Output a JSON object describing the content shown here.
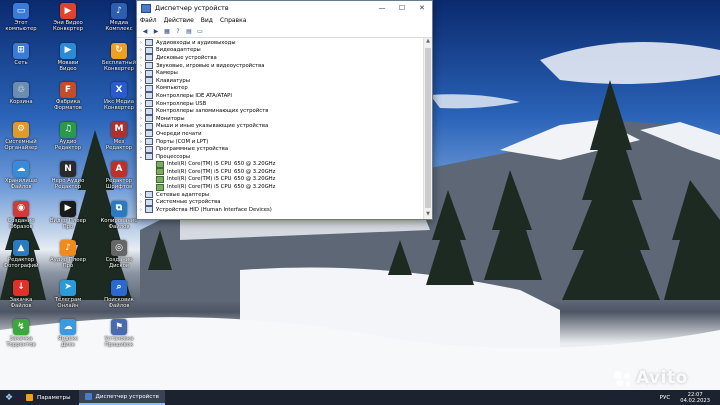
{
  "window": {
    "title": "Диспетчер устройств",
    "menu": [
      "Файл",
      "Действие",
      "Вид",
      "Справка"
    ],
    "categories_before": [
      "Аудиовходы и аудиовыходы",
      "Видеоадаптеры",
      "Дисковые устройства",
      "Звуковые, игровые и видеоустройства",
      "Камеры",
      "Клавиатуры",
      "Компьютер",
      "Контроллеры IDE ATA/ATAPI",
      "Контроллеры USB",
      "Контроллеры запоминающих устройств",
      "Мониторы",
      "Мыши и иные указывающие устройства",
      "Очереди печати",
      "Порты (COM и LPT)",
      "Программные устройства"
    ],
    "expanded_category": "Процессоры",
    "processors": [
      {
        "name": "Intel(R) Core(TM) i5 CPU",
        "speed": "650 @ 3.20GHz"
      },
      {
        "name": "Intel(R) Core(TM) i5 CPU",
        "speed": "650 @ 3.20GHz"
      },
      {
        "name": "Intel(R) Core(TM) i5 CPU",
        "speed": "650 @ 3.20GHz"
      },
      {
        "name": "Intel(R) Core(TM) i5 CPU",
        "speed": "650 @ 3.20GHz"
      }
    ],
    "categories_after": [
      "Сетевые адаптеры",
      "Системные устройства",
      "Устройства HID (Human Interface Devices)"
    ]
  },
  "desktop_icons": [
    {
      "label": "Этот\nкомпьютер",
      "color": "#3b7bd8",
      "glyph": "▭",
      "name": "computer-icon"
    },
    {
      "label": "Эни Видео\nКонвертер",
      "color": "#e0432d",
      "glyph": "▶",
      "name": "video-converter-icon"
    },
    {
      "label": "Медиа\nКомплекс",
      "color": "#2d5fb0",
      "glyph": "♪",
      "name": "media-icon"
    },
    {
      "label": "Сеть",
      "color": "#3b7bd8",
      "glyph": "⊞",
      "name": "network-icon"
    },
    {
      "label": "Мовави\nВидео",
      "color": "#2c8ad6",
      "glyph": "▶",
      "name": "video-editor-icon"
    },
    {
      "label": "Бесплатный\nКонвертер",
      "color": "#f0a020",
      "glyph": "↻",
      "name": "converter-icon"
    },
    {
      "label": "Корзина",
      "color": "#6a8db0",
      "glyph": "♲",
      "name": "recycle-bin-icon"
    },
    {
      "label": "Фабрика\nФорматов",
      "color": "#c54b2a",
      "glyph": "F",
      "name": "format-factory-icon"
    },
    {
      "label": "Икс Медиа\nКонвертер",
      "color": "#2a5ad0",
      "glyph": "X",
      "name": "media-converter-icon"
    },
    {
      "label": "Системный\nОрганайзер",
      "color": "#e09a2a",
      "glyph": "⚙",
      "name": "organizer-icon"
    },
    {
      "label": "Аудио\nРедактор",
      "color": "#2a9a4a",
      "glyph": "♫",
      "name": "audio-editor-icon"
    },
    {
      "label": "Мез\nРедактор",
      "color": "#b03030",
      "glyph": "M",
      "name": "editor-icon"
    },
    {
      "label": "Хранилище\nФайлов",
      "color": "#3a8ad8",
      "glyph": "☁",
      "name": "storage-icon"
    },
    {
      "label": "Неро Аудио\nРедактор",
      "color": "#2a2a2a",
      "glyph": "N",
      "name": "nero-icon"
    },
    {
      "label": "Редактор\nШрифтов",
      "color": "#c0302a",
      "glyph": "A",
      "name": "font-editor-icon"
    },
    {
      "label": "Создание\nОбразов",
      "color": "#d03a3a",
      "glyph": "◉",
      "name": "disc-image-icon"
    },
    {
      "label": "Видео Плеер\nПро",
      "color": "#1a1a1a",
      "glyph": "▶",
      "name": "video-player-icon"
    },
    {
      "label": "Копирование\nФайлов",
      "color": "#2a7ac0",
      "glyph": "⧉",
      "name": "copy-files-icon"
    },
    {
      "label": "Редактор\nФотографий",
      "color": "#2a7ac0",
      "glyph": "▲",
      "name": "photo-editor-icon"
    },
    {
      "label": "Аудио Плеер\nПро",
      "color": "#f08a1a",
      "glyph": "♪",
      "name": "audio-player-icon"
    },
    {
      "label": "Создание\nДисков",
      "color": "#666666",
      "glyph": "◎",
      "name": "disc-burner-icon"
    },
    {
      "label": "Закачка\nФайлов",
      "color": "#e0302a",
      "glyph": "↓",
      "name": "download-icon"
    },
    {
      "label": "Телеграм\nОнлайн",
      "color": "#2a9ad8",
      "glyph": "➤",
      "name": "telegram-icon"
    },
    {
      "label": "Поисковик\nФайлов",
      "color": "#2a6ad0",
      "glyph": "⌕",
      "name": "file-search-icon"
    },
    {
      "label": "Закачка\nТоррентов",
      "color": "#3aa83a",
      "glyph": "↯",
      "name": "torrent-icon"
    },
    {
      "label": "Яндекс\nДиск",
      "color": "#3a9ae0",
      "glyph": "☁",
      "name": "yandex-disk-icon"
    },
    {
      "label": "Установка\nПрошивок",
      "color": "#4a6ab0",
      "glyph": "⚑",
      "name": "firmware-icon"
    }
  ],
  "taskbar": {
    "items": [
      {
        "label": "Параметры",
        "active": false
      },
      {
        "label": "Диспетчер устройств",
        "active": true
      }
    ],
    "language": "РУС",
    "time": "22:07",
    "date": "04.02.2023"
  },
  "watermark": "Avito"
}
